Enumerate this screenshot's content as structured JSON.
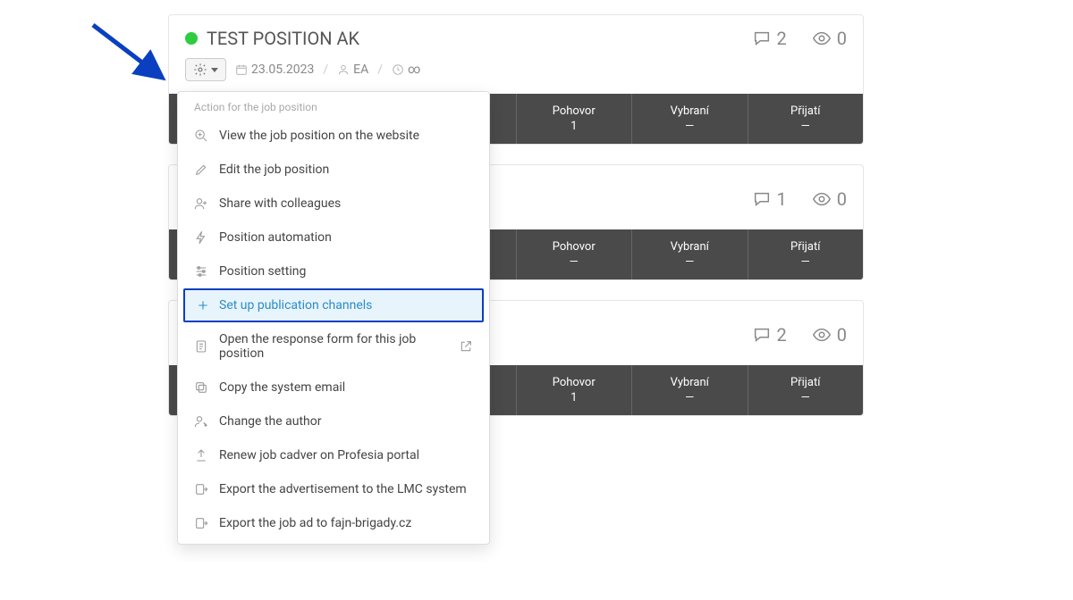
{
  "cards": [
    {
      "title": "TEST POSITION AK",
      "comments": "2",
      "views": "0",
      "date": "23.05.2023",
      "author": "EA",
      "expiry": "∞",
      "stats": [
        {
          "label": "",
          "value": ""
        },
        {
          "label": "",
          "value": ""
        },
        {
          "label": "",
          "value": ""
        },
        {
          "label": "Pohovor",
          "value": "1"
        },
        {
          "label": "Vybraní",
          "value": "—"
        },
        {
          "label": "Přijatí",
          "value": "—"
        }
      ]
    },
    {
      "title": "",
      "comments": "1",
      "views": "0",
      "stats": [
        {
          "label": "",
          "value": ""
        },
        {
          "label": "",
          "value": ""
        },
        {
          "label": "",
          "value": ""
        },
        {
          "label": "Pohovor",
          "value": "—"
        },
        {
          "label": "Vybraní",
          "value": "—"
        },
        {
          "label": "Přijatí",
          "value": "—"
        }
      ]
    },
    {
      "title": "",
      "comments": "2",
      "views": "0",
      "stats": [
        {
          "label": "",
          "value": ""
        },
        {
          "label": "",
          "value": ""
        },
        {
          "label": "",
          "value": ""
        },
        {
          "label": "Pohovor",
          "value": "1"
        },
        {
          "label": "Vybraní",
          "value": "—"
        },
        {
          "label": "Přijatí",
          "value": "—"
        }
      ]
    }
  ],
  "dropdown": {
    "header": "Action for the job position",
    "items": [
      {
        "icon": "magnify-plus",
        "label": "View the job position on the website"
      },
      {
        "icon": "pencil",
        "label": "Edit the job position"
      },
      {
        "icon": "user-plus",
        "label": "Share with colleagues"
      },
      {
        "icon": "bolt",
        "label": "Position automation"
      },
      {
        "icon": "sliders",
        "label": "Position setting"
      },
      {
        "icon": "plus",
        "label": "Set up publication channels",
        "highlight": true
      },
      {
        "icon": "form",
        "label": "Open the response form for this job position",
        "ext": true
      },
      {
        "icon": "copy",
        "label": "Copy the system email"
      },
      {
        "icon": "user-edit",
        "label": "Change the author"
      },
      {
        "icon": "upload",
        "label": "Renew job cadver on Profesia portal"
      },
      {
        "icon": "export",
        "label": "Export the advertisement to the LMC system"
      },
      {
        "icon": "export",
        "label": "Export the job ad to fajn-brigady.cz"
      }
    ]
  }
}
